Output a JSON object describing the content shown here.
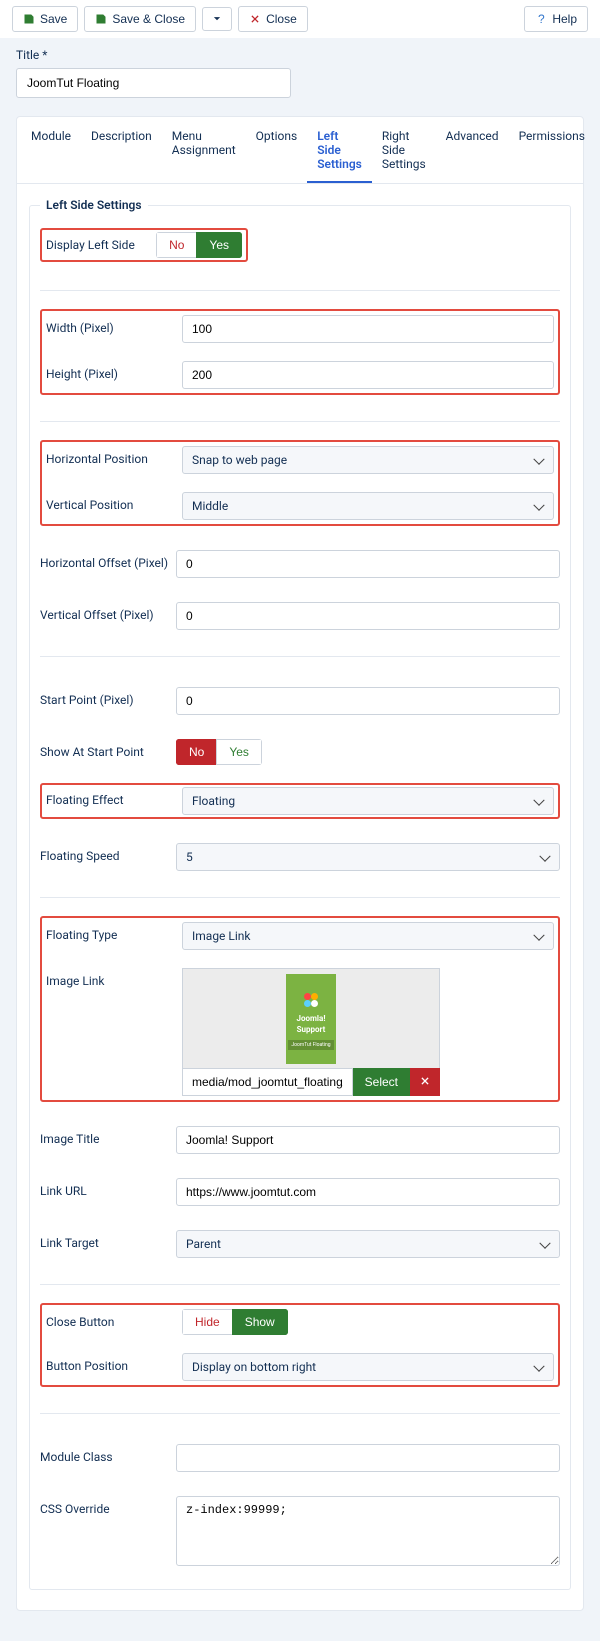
{
  "toolbar": {
    "save": "Save",
    "save_close": "Save & Close",
    "close": "Close",
    "help": "Help"
  },
  "title": {
    "label": "Title *",
    "value": "JoomTut Floating"
  },
  "tabs": {
    "t0": "Module",
    "t1": "Description",
    "t2": "Menu Assignment",
    "t3": "Options",
    "t4": "Left Side Settings",
    "t5": "Right Side Settings",
    "t6": "Advanced",
    "t7": "Permissions"
  },
  "fieldset_legend": "Left Side Settings",
  "labels": {
    "display": "Display Left Side",
    "width": "Width (Pixel)",
    "height": "Height (Pixel)",
    "hpos": "Horizontal Position",
    "vpos": "Vertical Position",
    "hoff": "Horizontal Offset (Pixel)",
    "voff": "Vertical Offset (Pixel)",
    "startp": "Start Point (Pixel)",
    "showstart": "Show At Start Point",
    "fx": "Floating Effect",
    "speed": "Floating Speed",
    "ftype": "Floating Type",
    "imglink": "Image Link",
    "imgtitle": "Image Title",
    "linkurl": "Link URL",
    "linktgt": "Link Target",
    "closeb": "Close Button",
    "btnpos": "Button Position",
    "mclass": "Module Class",
    "cssov": "CSS Override"
  },
  "values": {
    "width": "100",
    "height": "200",
    "hpos": "Snap to web page",
    "vpos": "Middle",
    "hoff": "0",
    "voff": "0",
    "startp": "0",
    "fx": "Floating",
    "speed": "5",
    "ftype": "Image Link",
    "imgpath": "media/mod_joomtut_floating/images/joomtut",
    "imgtitle": "Joomla! Support",
    "linkurl": "https://www.joomtut.com",
    "linktgt": "Parent",
    "btnpos": "Display on bottom right",
    "mclass": "",
    "cssov": "z-index:99999;"
  },
  "toggles": {
    "no": "No",
    "yes": "Yes",
    "hide": "Hide",
    "show": "Show"
  },
  "buttons": {
    "select": "Select"
  },
  "thumb": {
    "t1": "Joomla!",
    "t2": "Support",
    "t3": "JoomTut Floating"
  }
}
